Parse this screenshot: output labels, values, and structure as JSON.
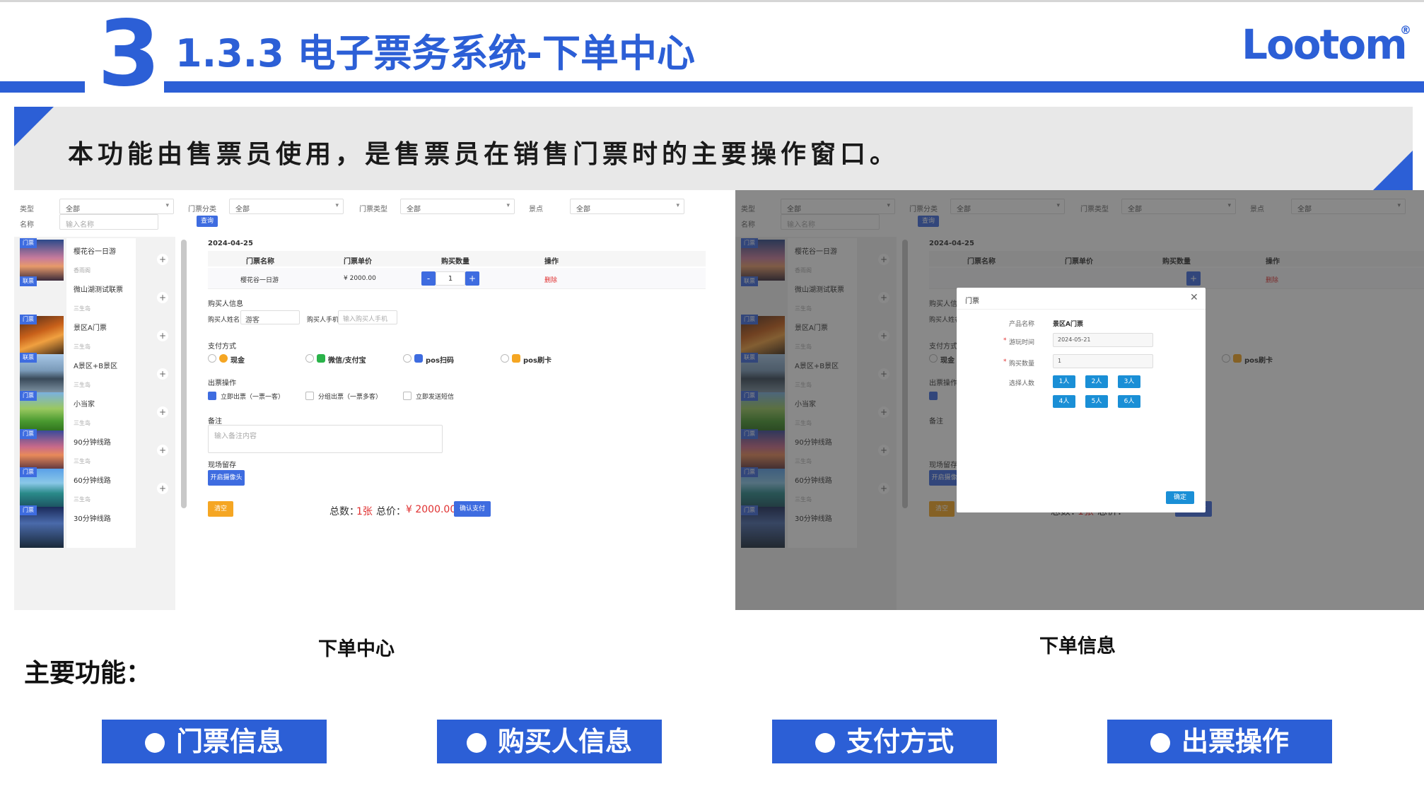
{
  "header": {
    "section_number": "3",
    "title": "1.3.3 电子票务系统-下单中心",
    "logo": "Lootom",
    "logo_mark": "®"
  },
  "banner": {
    "text": "本功能由售票员使用，是售票员在销售门票时的主要操作窗口。"
  },
  "screens": {
    "filters": {
      "type_label": "类型",
      "type_value": "全部",
      "category_label": "门票分类",
      "category_value": "全部",
      "ticket_type_label": "门票类型",
      "ticket_type_value": "全部",
      "spot_label": "景点",
      "spot_value": "全部",
      "name_label": "名称",
      "name_placeholder": "输入名称",
      "query_button": "查询"
    },
    "products": [
      {
        "badge": "门票",
        "name": "樱花谷一日游",
        "sub": "香雨阁"
      },
      {
        "badge": "联票",
        "name": "微山湖测试联票",
        "sub": "三生岛"
      },
      {
        "badge": "门票",
        "name": "景区A门票",
        "sub": "三生岛"
      },
      {
        "badge": "联票",
        "name": "A景区+B景区",
        "sub": "三生岛"
      },
      {
        "badge": "门票",
        "name": "小当家",
        "sub": "三生岛"
      },
      {
        "badge": "门票",
        "name": "90分钟线路",
        "sub": "三生岛"
      },
      {
        "badge": "门票",
        "name": "60分钟线路",
        "sub": "三生岛"
      },
      {
        "badge": "门票",
        "name": "30分钟线路",
        "sub": "三生岛"
      }
    ],
    "order": {
      "date": "2024-04-25",
      "col_name": "门票名称",
      "col_price": "门票单价",
      "col_qty": "购买数量",
      "col_action": "操作",
      "row_name": "樱花谷一日游",
      "row_price": "¥ 2000.00",
      "row_qty": "1",
      "row_delete": "删除",
      "buyer_section": "购买人信息",
      "buyer_name_label": "购买人姓名",
      "buyer_name_value": "游客",
      "buyer_phone_label": "购买人手机",
      "buyer_phone_placeholder": "输入购买人手机",
      "pay_section": "支付方式",
      "pay_cash": "现金",
      "pay_wechat": "微信/支付宝",
      "pay_pos_scan": "pos扫码",
      "pay_pos_card": "pos刷卡",
      "issue_section": "出票操作",
      "issue_now": "立即出票（一票一客）",
      "issue_group": "分组出票（一票多客）",
      "issue_sms": "立即发送短信",
      "remark_section": "备注",
      "remark_placeholder": "输入备注内容",
      "photo_section": "现场留存",
      "photo_button": "开启摄像头",
      "clear_button": "清空",
      "total_label": "总数：",
      "total_count": "1张",
      "total_price_label": "总价：",
      "total_price": "¥ 2000.00",
      "confirm_pay": "确认支付"
    },
    "modal": {
      "title": "门票",
      "product_label": "产品名称",
      "product_value": "景区A门票",
      "date_label": "游玩时间",
      "date_value": "2024-05-21",
      "qty_label": "购买数量",
      "qty_value": "1",
      "people_label": "选择人数",
      "people_options": [
        "1人",
        "2人",
        "3人",
        "4人",
        "5人",
        "6人"
      ],
      "confirm": "确定",
      "required_mark": "*"
    }
  },
  "captions": {
    "left": "下单中心",
    "right": "下单信息",
    "main_functions": "主要功能："
  },
  "features": [
    "门票信息",
    "购买人信息",
    "支付方式",
    "出票操作"
  ],
  "colors": {
    "brand_blue": "#2c5fd6",
    "app_blue": "#3e6ce0",
    "price_red": "#e03030",
    "orange": "#f5a623",
    "modal_chip": "#1a8fd6"
  }
}
